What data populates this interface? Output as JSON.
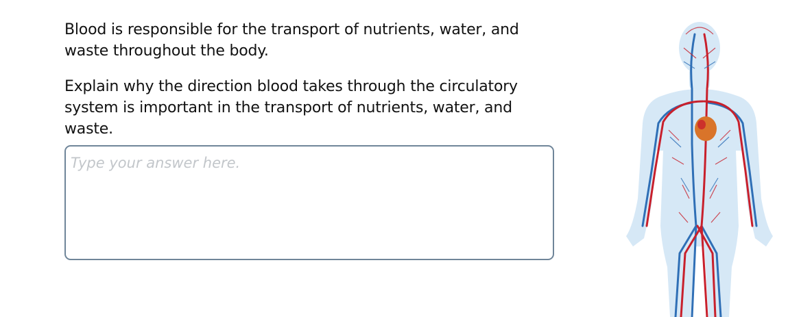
{
  "question": {
    "intro": "Blood is responsible for the transport of nutrients, water, and waste throughout the body.",
    "prompt": "Explain why the direction blood takes through the circulatory system is important in the transport of nutrients, water, and waste."
  },
  "answer": {
    "placeholder": "Type your answer here.",
    "value": ""
  },
  "figure": {
    "icon": "human-circulatory-system-illustration",
    "colors": {
      "body": "#d6e8f6",
      "artery": "#c8202c",
      "vein": "#2f6fb6",
      "heart": "#d9742a"
    }
  }
}
